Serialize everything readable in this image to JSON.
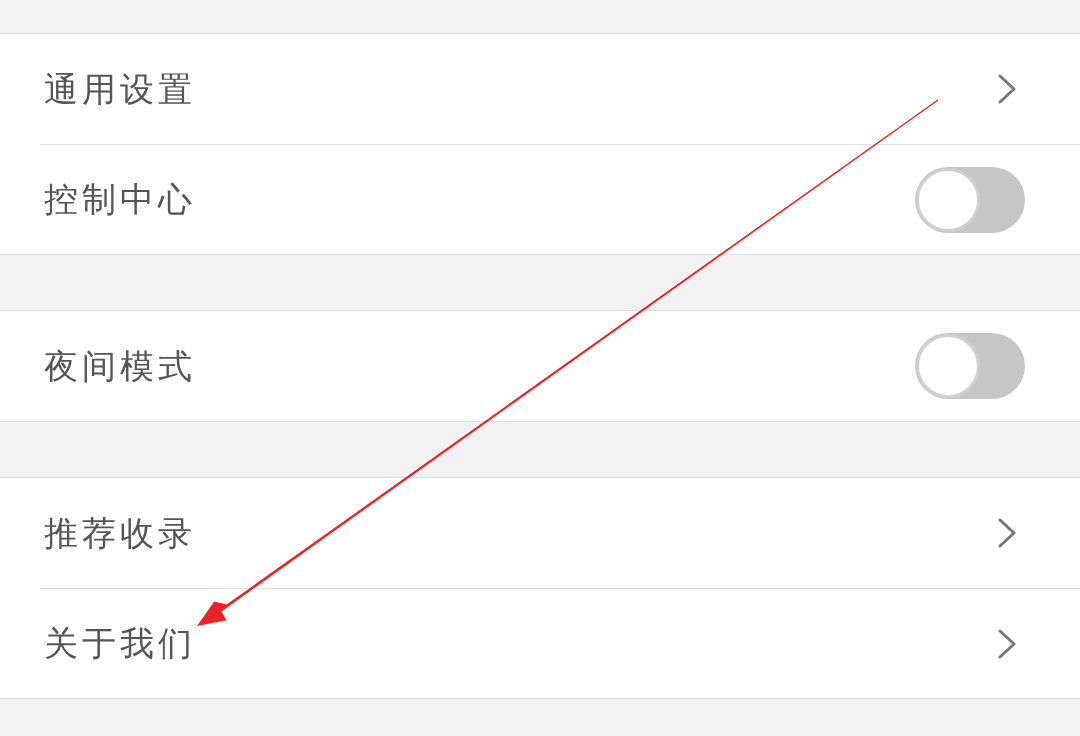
{
  "groups": [
    {
      "items": [
        {
          "label": "通用设置",
          "kind": "link"
        },
        {
          "label": "控制中心",
          "kind": "switch",
          "on": false
        }
      ]
    },
    {
      "items": [
        {
          "label": "夜间模式",
          "kind": "switch",
          "on": false
        }
      ]
    },
    {
      "items": [
        {
          "label": "推荐收录",
          "kind": "link"
        },
        {
          "label": "关于我们",
          "kind": "link"
        }
      ]
    }
  ]
}
